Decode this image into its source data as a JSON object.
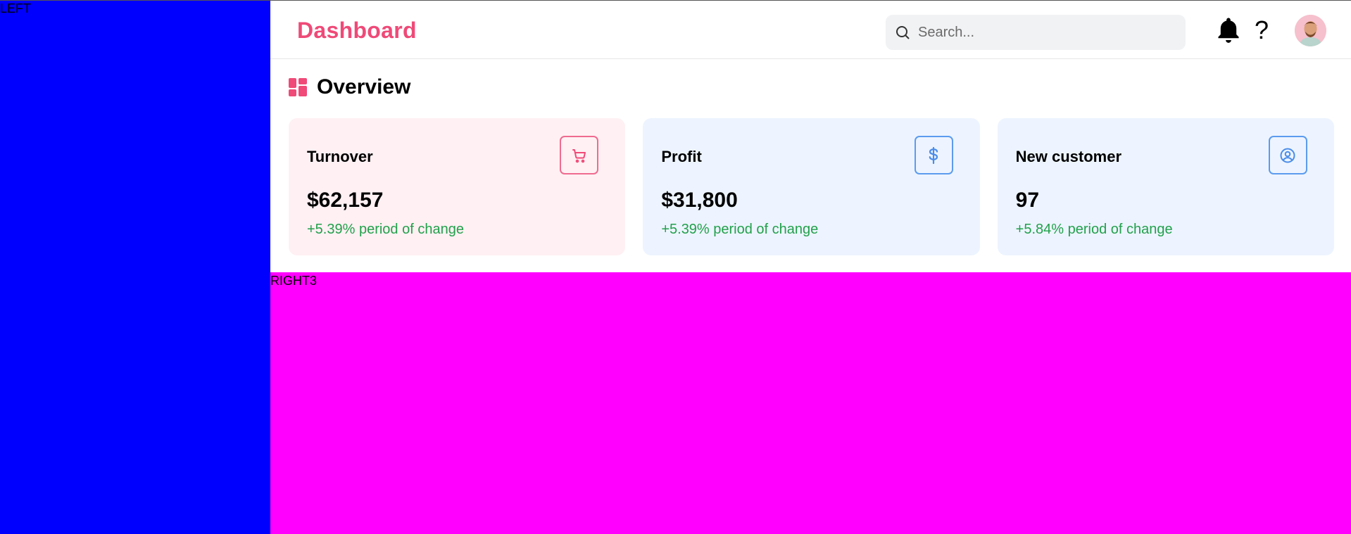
{
  "panels": {
    "left_label": "LEFT",
    "right_bottom_label": "RIGHT3",
    "left_color": "#0000ff",
    "right_bottom_color": "#ff00ff"
  },
  "header": {
    "title": "Dashboard",
    "brand_color": "#ef4a78",
    "search_placeholder": "Search...",
    "search_value": "",
    "icons": [
      "search-icon",
      "bell-icon",
      "help-icon",
      "avatar"
    ],
    "help_glyph": "?"
  },
  "overview": {
    "title": "Overview",
    "icon": "dashboard-grid-icon",
    "cards": [
      {
        "label": "Turnover",
        "value": "$62,157",
        "change": "+5.39% period of change",
        "icon": "cart-icon",
        "bg": "#fff0f3",
        "accent": "#ef6b90"
      },
      {
        "label": "Profit",
        "value": "$31,800",
        "change": "+5.39% period of change",
        "icon": "dollar-icon",
        "bg": "#edf4ff",
        "accent": "#5b9bef"
      },
      {
        "label": "New customer",
        "value": "97",
        "change": "+5.84% period of change",
        "icon": "user-circle-icon",
        "bg": "#edf4ff",
        "accent": "#5b9bef"
      }
    ],
    "change_color": "#22a04b"
  }
}
